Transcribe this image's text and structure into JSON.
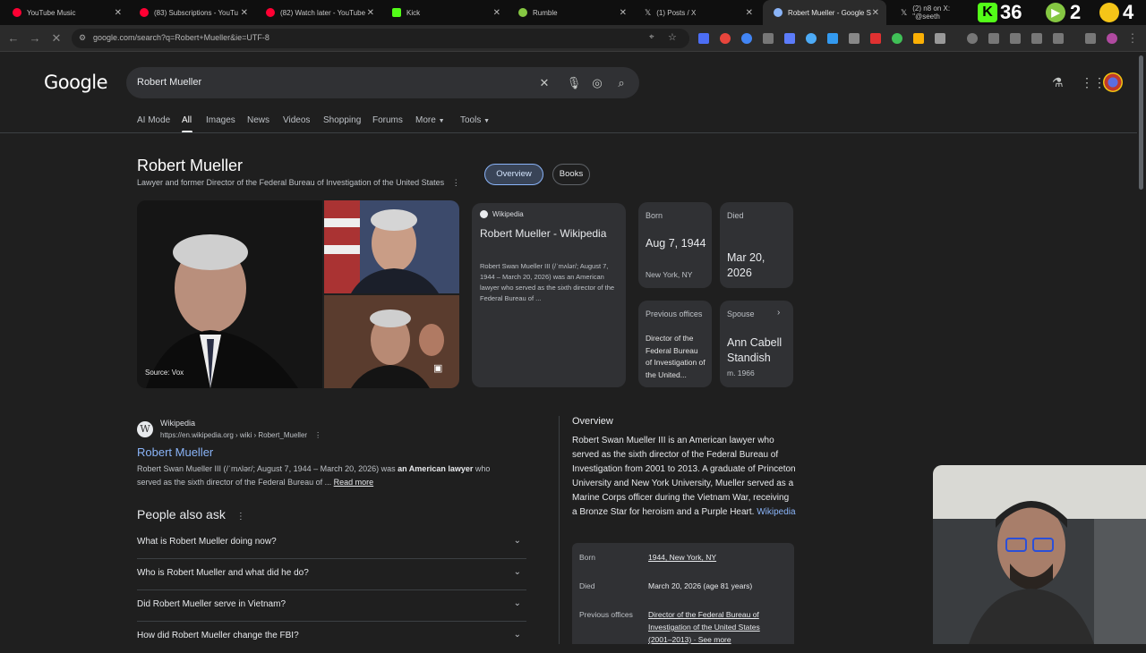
{
  "browser": {
    "tabs": [
      {
        "title": "YouTube Music",
        "color": "#ff0033"
      },
      {
        "title": "(83) Subscriptions - YouTu",
        "color": "#ff0033"
      },
      {
        "title": "(82) Watch later - YouTube",
        "color": "#ff0033"
      },
      {
        "title": "Kick",
        "color": "#53fc18"
      },
      {
        "title": "Rumble",
        "color": "#85c742"
      },
      {
        "title": "(1) Posts / X",
        "color": "#ffffff"
      },
      {
        "title": "Robert Mueller - Google S",
        "color": "#8ab4f8"
      },
      {
        "title": "(2) n8 on X: \"@seeth",
        "color": "#ffffff"
      }
    ],
    "overlay": {
      "kick_count": "36",
      "rumble_count": "2",
      "other_count": "4"
    },
    "url": "google.com/search?q=Robert+Mueller&ie=UTF-8"
  },
  "google": {
    "logo": "Google",
    "query": "Robert Mueller",
    "tabs": [
      "AI Mode",
      "All",
      "Images",
      "News",
      "Videos",
      "Shopping",
      "Forums",
      "More",
      "Tools"
    ]
  },
  "knowledge": {
    "title": "Robert Mueller",
    "subtitle": "Lawyer and former Director of the Federal Bureau of Investigation of the United States",
    "pills": [
      "Overview",
      "Books"
    ],
    "photo_source": "Source: Vox",
    "wiki_card": {
      "source": "Wikipedia",
      "title": "Robert Mueller - Wikipedia",
      "snippet": "Robert Swan Mueller III (/ˈmʌlər/; August 7, 1944 – March 20, 2026) was an American lawyer who served as the sixth director of the Federal Bureau of ..."
    },
    "born": {
      "label": "Born",
      "value": "Aug 7, 1944",
      "place": "New York, NY"
    },
    "died": {
      "label": "Died",
      "value": "Mar 20, 2026"
    },
    "offices": {
      "label": "Previous offices",
      "value": "Director of the Federal Bureau of Investigation of the United..."
    },
    "spouse": {
      "label": "Spouse",
      "value": "Ann Cabell Standish",
      "note": "m. 1966"
    }
  },
  "result": {
    "site": "Wikipedia",
    "url": "https://en.wikipedia.org › wiki › Robert_Mueller",
    "title": "Robert Mueller",
    "snippet_a": "Robert Swan Mueller III (/ˈmʌlər/; August 7, 1944 – March 20, 2026) was ",
    "snippet_b": "an American lawyer",
    "snippet_c": " who served as the sixth director of the Federal Bureau of ... ",
    "read_more": "Read more"
  },
  "paa": {
    "heading": "People also ask",
    "questions": [
      "What is Robert Mueller doing now?",
      "Who is Robert Mueller and what did he do?",
      "Did Robert Mueller serve in Vietnam?",
      "How did Robert Mueller change the FBI?"
    ]
  },
  "overview": {
    "heading": "Overview",
    "text": "Robert Swan Mueller III is an American lawyer who served as the sixth director of the Federal Bureau of Investigation from 2001 to 2013. A graduate of Princeton University and New York University, Mueller served as a Marine Corps officer during the Vietnam War, receiving a Bronze Star for heroism and a Purple Heart. ",
    "link": "Wikipedia",
    "rows": [
      {
        "label": "Born",
        "value": "1944, New York, NY"
      },
      {
        "label": "Died",
        "value": "March 20, 2026 (age 81 years)"
      },
      {
        "label": "Previous offices",
        "value": "Director of the Federal Bureau of Investigation of the United States (2001–2013) · See more"
      }
    ]
  }
}
